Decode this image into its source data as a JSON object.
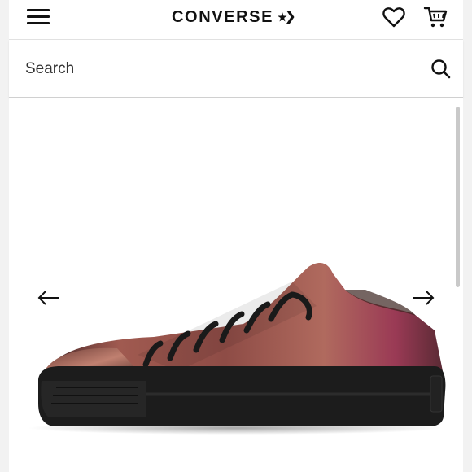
{
  "header": {
    "brand": "CONVERSE",
    "menu_icon": "hamburger-menu-icon",
    "wishlist_icon": "heart-icon",
    "cart_icon": "shopping-cart-icon",
    "brand_icon": "star-chevron-icon"
  },
  "search": {
    "placeholder": "Search",
    "icon": "search-icon"
  },
  "gallery": {
    "prev_icon": "arrow-left-icon",
    "next_icon": "arrow-right-icon",
    "image": "metallic-rose-gold-low-top-sneaker"
  },
  "colors": {
    "text": "#111111",
    "background": "#ffffff",
    "outer_background": "#f2f2f2",
    "shoe_upper": "#8a4a42",
    "shoe_sole": "#1a1a1a"
  }
}
